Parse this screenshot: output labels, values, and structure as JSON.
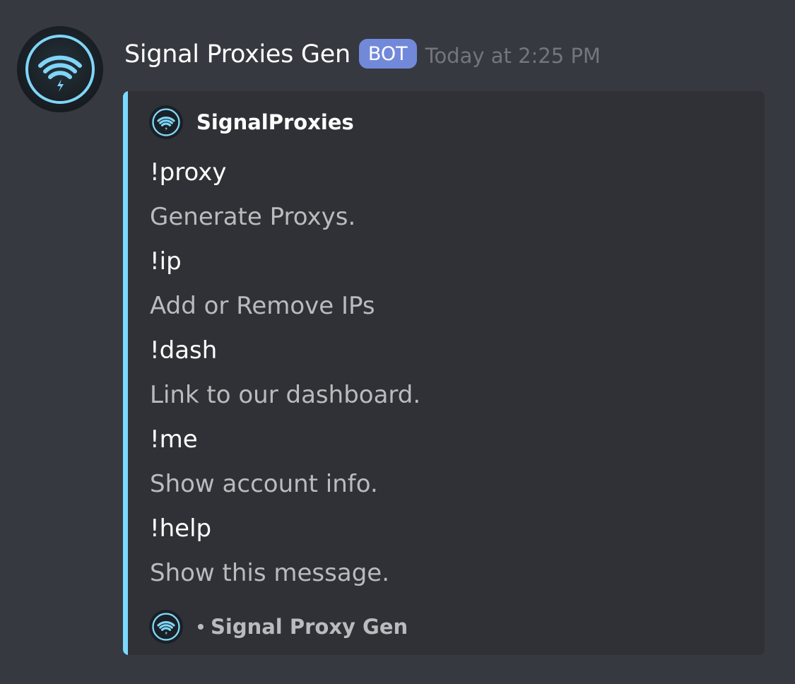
{
  "message": {
    "author": "Signal Proxies Gen",
    "bot_tag": "BOT",
    "timestamp": "Today at 2:25 PM",
    "avatar_icon": "wifi-icon"
  },
  "embed": {
    "accent_color": "#7dd8ff",
    "author_name": "SignalProxies",
    "fields": [
      {
        "name": "!proxy",
        "value": "Generate Proxys."
      },
      {
        "name": "!ip",
        "value": "Add or Remove IPs"
      },
      {
        "name": "!dash",
        "value": "Link to our dashboard."
      },
      {
        "name": "!me",
        "value": "Show account info."
      },
      {
        "name": "!help",
        "value": "Show this message."
      }
    ],
    "footer_text": "Signal Proxy Gen"
  },
  "colors": {
    "background": "#36393f",
    "embed_background": "#2f3136",
    "bot_tag": "#7289da",
    "timestamp": "#72767d",
    "field_value": "#b9bbbe"
  }
}
